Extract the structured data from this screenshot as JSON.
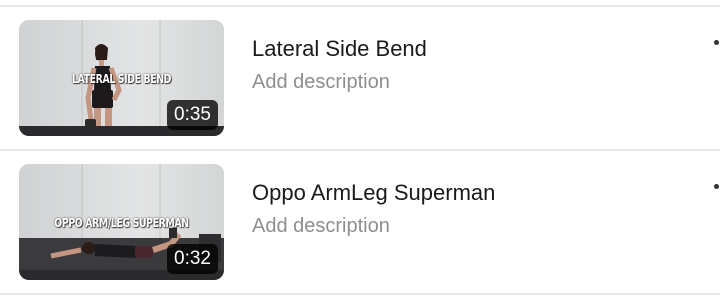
{
  "videos": [
    {
      "overlay_text": "LATERAL SIDE BEND",
      "duration": "0:35",
      "title": "Lateral Side Bend",
      "description_placeholder": "Add description"
    },
    {
      "overlay_text": "OPPO ARM/LEG SUPERMAN",
      "duration": "0:32",
      "title": "Oppo ArmLeg Superman",
      "description_placeholder": "Add description"
    }
  ],
  "icons": {
    "more": "more-options-icon"
  }
}
